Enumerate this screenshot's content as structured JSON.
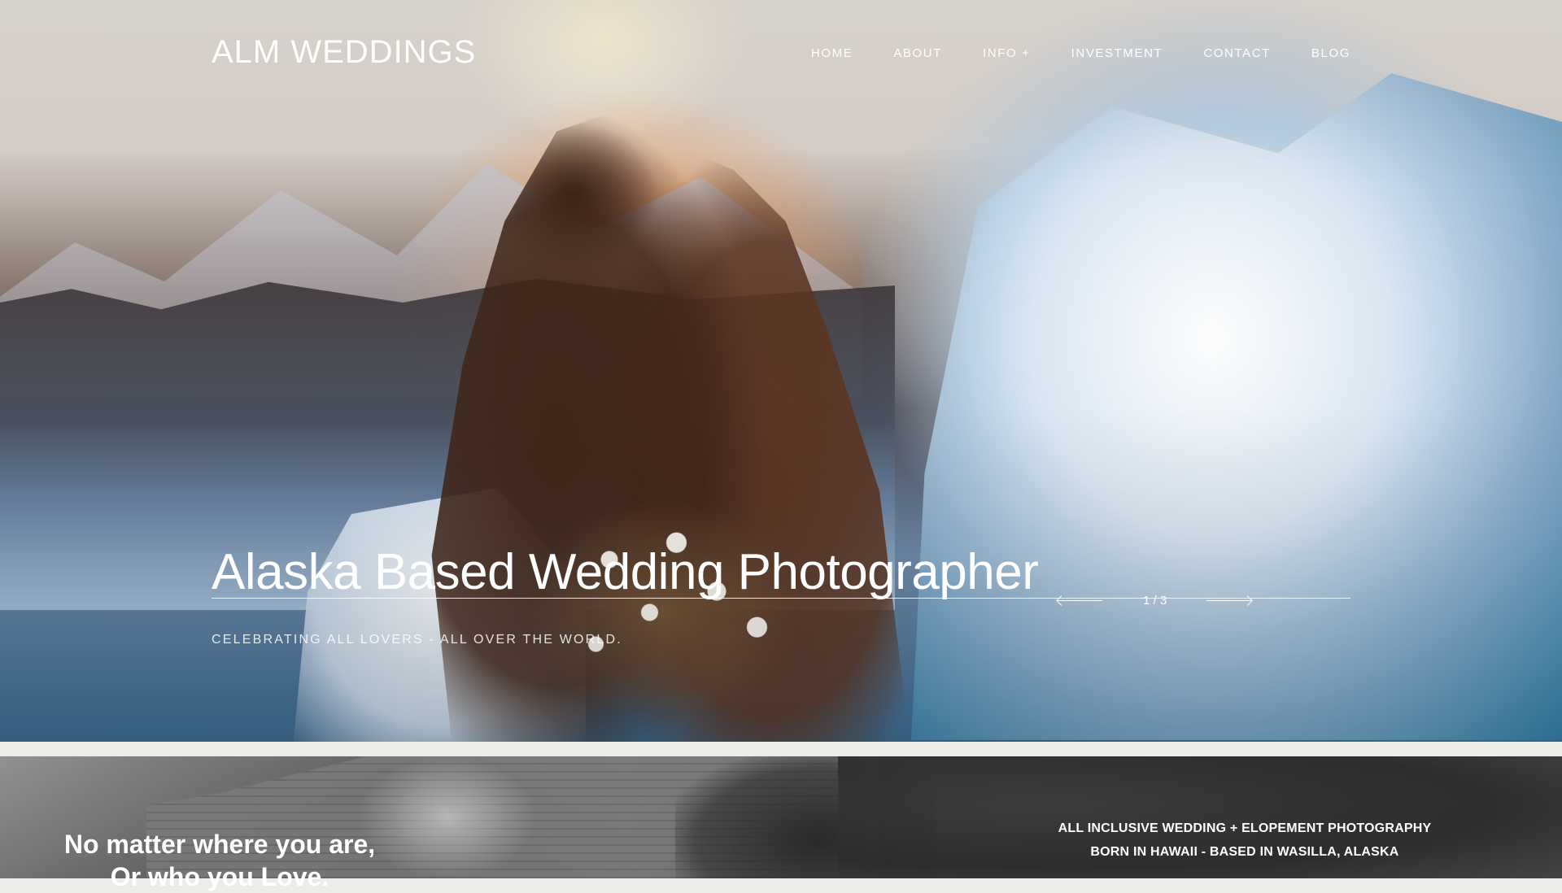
{
  "header": {
    "logo": "ALM WEDDINGS",
    "nav": [
      {
        "label": "HOME"
      },
      {
        "label": "ABOUT"
      },
      {
        "label": "INFO",
        "suffix": "+"
      },
      {
        "label": "INVESTMENT"
      },
      {
        "label": "CONTACT"
      },
      {
        "label": "BLOG"
      }
    ]
  },
  "hero": {
    "title": "Alaska Based Wedding Photographer",
    "subtitle": "CELEBRATING  ALL LOVERS - ALL OVER THE WORLD.",
    "slider": {
      "counter": "1 / 3"
    }
  },
  "section2": {
    "tagline_line1": "No matter where you are,",
    "tagline_line2": "Or who you Love.",
    "info_line1": "ALL INCLUSIVE WEDDING + ELOPEMENT PHOTOGRAPHY",
    "info_line2": "BORN IN HAWAII - BASED IN WASILLA, ALASKA"
  }
}
